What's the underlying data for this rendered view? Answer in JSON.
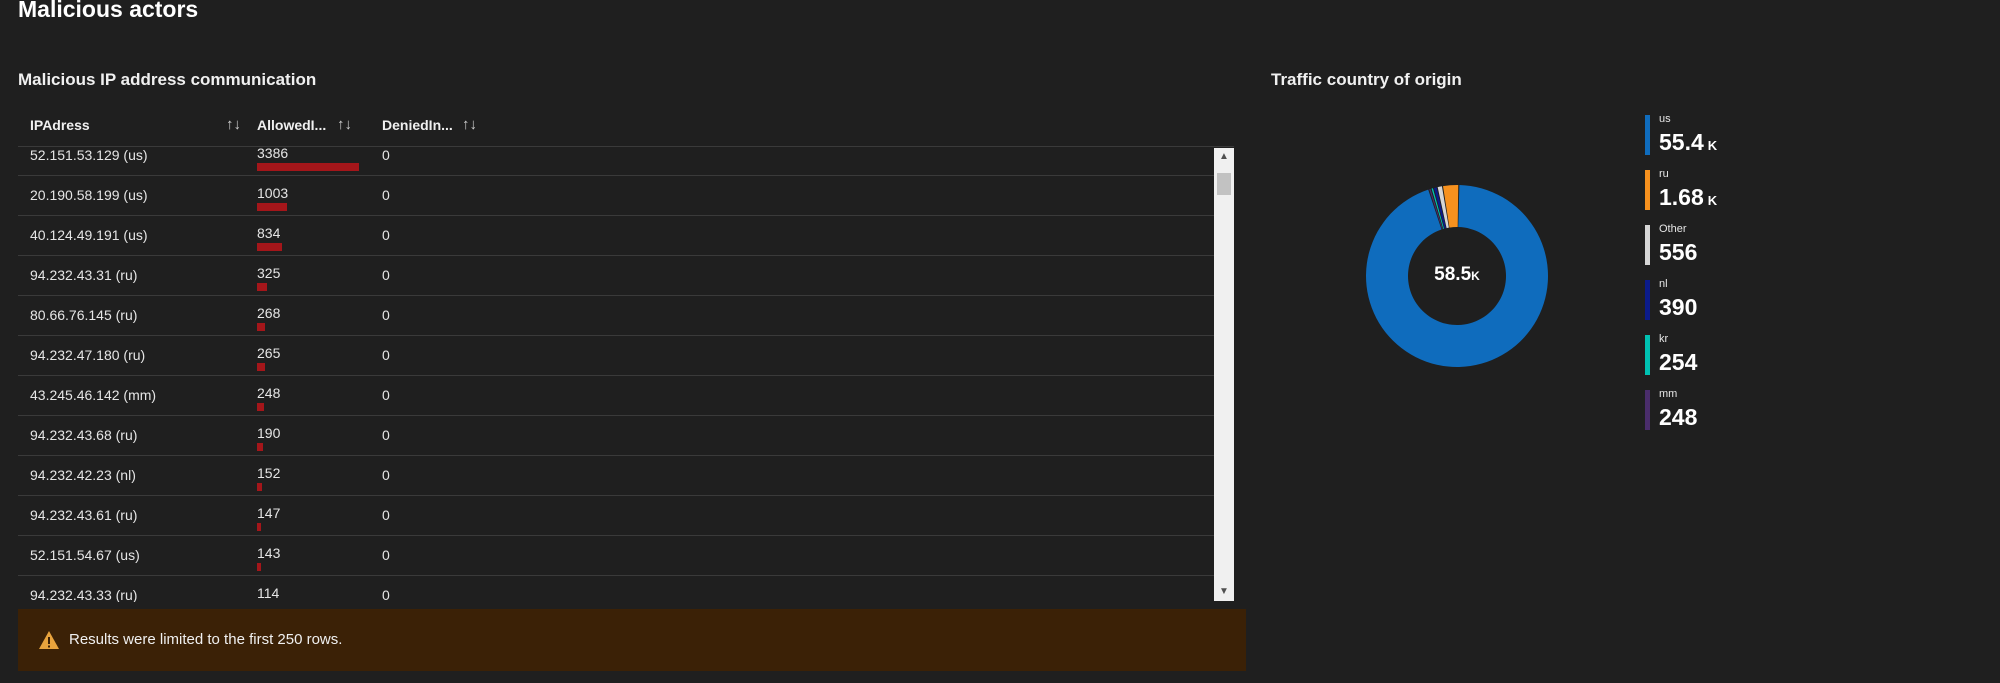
{
  "page": {
    "title": "Malicious actors"
  },
  "grid": {
    "title": "Malicious IP address communication",
    "columns": {
      "ip": "IPAdress",
      "allowed": "AllowedI...",
      "denied": "DeniedIn...",
      "sort_glyph": "↑↓"
    },
    "rows": [
      {
        "ip": "52.151.53.129 (us)",
        "allowed": "3386",
        "allowed_value": 3386,
        "denied": "0"
      },
      {
        "ip": "20.190.58.199 (us)",
        "allowed": "1003",
        "allowed_value": 1003,
        "denied": "0"
      },
      {
        "ip": "40.124.49.191 (us)",
        "allowed": "834",
        "allowed_value": 834,
        "denied": "0"
      },
      {
        "ip": "94.232.43.31 (ru)",
        "allowed": "325",
        "allowed_value": 325,
        "denied": "0"
      },
      {
        "ip": "80.66.76.145 (ru)",
        "allowed": "268",
        "allowed_value": 268,
        "denied": "0"
      },
      {
        "ip": "94.232.47.180 (ru)",
        "allowed": "265",
        "allowed_value": 265,
        "denied": "0"
      },
      {
        "ip": "43.245.46.142 (mm)",
        "allowed": "248",
        "allowed_value": 248,
        "denied": "0"
      },
      {
        "ip": "94.232.43.68 (ru)",
        "allowed": "190",
        "allowed_value": 190,
        "denied": "0"
      },
      {
        "ip": "94.232.42.23 (nl)",
        "allowed": "152",
        "allowed_value": 152,
        "denied": "0"
      },
      {
        "ip": "94.232.43.61 (ru)",
        "allowed": "147",
        "allowed_value": 147,
        "denied": "0"
      },
      {
        "ip": "52.151.54.67 (us)",
        "allowed": "143",
        "allowed_value": 143,
        "denied": "0"
      },
      {
        "ip": "94.232.43.33 (ru)",
        "allowed": "114",
        "allowed_value": 114,
        "denied": "0"
      }
    ],
    "bar_color": "#a4161a",
    "scroll_up_glyph": "▲",
    "scroll_down_glyph": "▼"
  },
  "warning": {
    "text": "Results were limited to the first 250 rows.",
    "icon": "warning-icon",
    "color": "#e8a33d"
  },
  "donut": {
    "title": "Traffic country of origin",
    "total_number": "58.5",
    "total_unit": "K",
    "segments": [
      {
        "label": "us",
        "value_number": "55.4",
        "value_unit": "K",
        "value": 55400,
        "color": "#0f6cbd"
      },
      {
        "label": "ru",
        "value_number": "1.68",
        "value_unit": "K",
        "value": 1680,
        "color": "#f7911e"
      },
      {
        "label": "Other",
        "value_number": "556",
        "value_unit": "",
        "value": 556,
        "color": "#d6d6d6"
      },
      {
        "label": "nl",
        "value_number": "390",
        "value_unit": "",
        "value": 390,
        "color": "#0b1b8a"
      },
      {
        "label": "kr",
        "value_number": "254",
        "value_unit": "",
        "value": 254,
        "color": "#00c2b2"
      },
      {
        "label": "mm",
        "value_number": "248",
        "value_unit": "",
        "value": 248,
        "color": "#4a2d6b"
      }
    ]
  }
}
